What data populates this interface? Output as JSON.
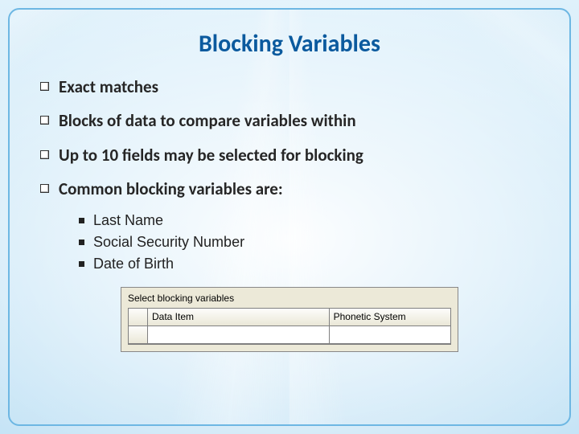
{
  "title": "Blocking Variables",
  "bullets": [
    {
      "text": "Exact matches"
    },
    {
      "text": "Blocks of data to compare variables within"
    },
    {
      "text": "Up to 10 fields may be selected for blocking"
    },
    {
      "text": "Common blocking variables are:"
    }
  ],
  "sub_bullets": [
    "Last Name",
    "Social Security Number",
    "Date of Birth"
  ],
  "screenshot": {
    "panel_label": "Select blocking variables",
    "columns": [
      "Data Item",
      "Phonetic System"
    ],
    "row_values": [
      "",
      ""
    ]
  }
}
